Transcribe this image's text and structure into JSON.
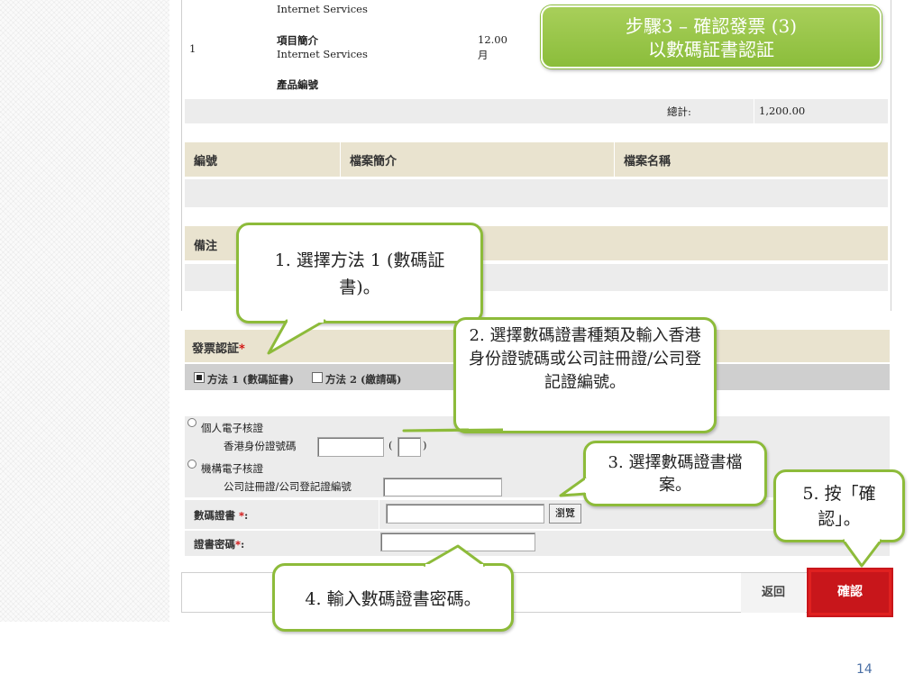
{
  "banner": {
    "line1": "步驟3 – 確認發票 (3)",
    "line2": "以數碼証書認証"
  },
  "invoice": {
    "item_desc_top": "Internet Services",
    "item_no": "1",
    "item_label": "項目簡介",
    "item_desc": "Internet Services",
    "qty": "12.00",
    "unit": "月",
    "product_code_label": "產品編號",
    "total_label": "總計:",
    "total_value": "1,200.00"
  },
  "attachments": {
    "headers": [
      "編號",
      "檔案簡介",
      "檔案名稱"
    ]
  },
  "remarks": {
    "label": "備注"
  },
  "auth": {
    "title": "發票認証",
    "required_mark": "*",
    "tab_method1": "方法 1 (數碼証書)",
    "tab_method2": "方法 2 (繳請碼)",
    "personal_cert_label": "個人電子核證",
    "hkid_label": "香港身份證號碼",
    "hkid_open": "(",
    "hkid_close": ")",
    "org_cert_label": "機構電子核證",
    "company_reg_label": "公司註冊證/公司登記證編號",
    "digital_cert_label": "數碼證書",
    "cert_password_label": "證書密碼",
    "browse_button": "瀏覽",
    "colon": ":"
  },
  "actions": {
    "back": "返回",
    "confirm": "確認"
  },
  "callouts": {
    "c1": "1. 選擇方法 1 (數碼証書)。",
    "c2": "2. 選擇數碼證書種類及輸入香港身份證號碼或公司註冊證/公司登記證編號。",
    "c3": "3. 選擇數碼證書檔案。",
    "c4": "4. 輸入數碼證書密碼。",
    "c5": "5. 按「確認」。"
  },
  "slide_number": "14",
  "colors": {
    "accent_green": "#8dbb3a",
    "confirm_red": "#c8161b",
    "beige": "#e9e3cf"
  }
}
